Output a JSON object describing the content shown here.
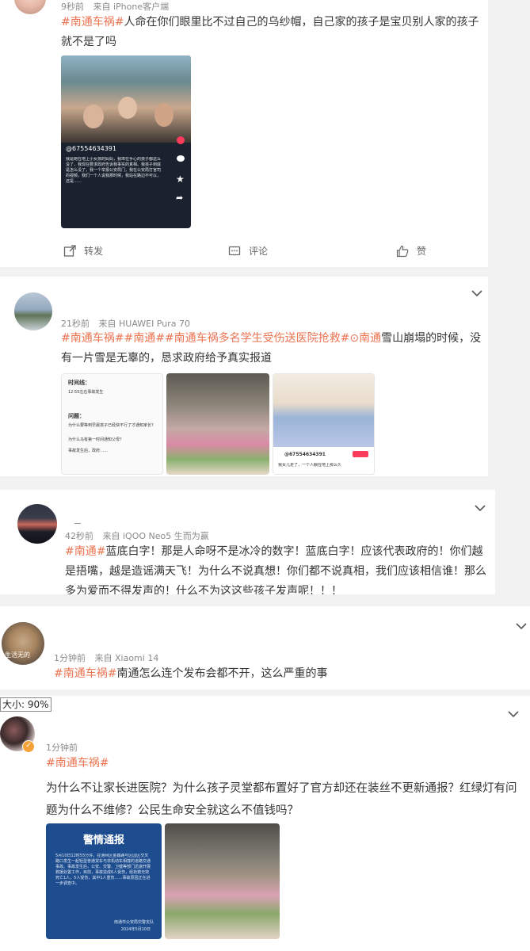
{
  "posts": [
    {
      "meta": "9秒前",
      "source": "来自 iPhone客户端",
      "tag": "#南通车祸#",
      "text": "人命在你们眼里比不过自己的乌纱帽，自己家的孩子是宝贝别人家的孩子就不是了吗",
      "video": {
        "handle": "@67554634391",
        "caption": "我是她在地上小女孩的妈妈，我埠在手心的孩子都这么没了，我现在要求政府告诉我事实的真相。我孩子到底是怎么没了，我一个举报公安局门，我在公安局打官司的视频，我们一个人说我那时候，我站在路边不可以，还是……"
      },
      "actions": {
        "repost": "转发",
        "comment": "评论",
        "like": "赞"
      }
    },
    {
      "meta": "21秒前",
      "source": "来自 HUAWEI Pura 70",
      "tags": [
        "#南通车祸#",
        "#南通#",
        "#南通车祸多名学生受伤送医院抢救#",
        "南通"
      ],
      "text": "雪山崩塌的时候，没有一片雪是无辜的，恳求政府给予真实报道",
      "image1": {
        "title": "时间线：",
        "line": "12:55左右事故发生",
        "sub": "问题：",
        "q1": "为什么要等到早晨孩子已经快不行了才通知家长？",
        "q2": "为什么马有第一时间通知父母？",
        "q3": "事故发生后，政府……"
      },
      "image3": {
        "handle": "@67554634391",
        "caption": "我女儿走了，一个人躺在地上那么久"
      }
    },
    {
      "meta": "42秒前",
      "source": "来自 iQOO Neo5 生而为赢",
      "tag": "#南通#",
      "text": "蓝底白字！那是人命呀不是冰冷的数字！蓝底白字！应该代表政府的！你们越是捂嘴，越是造谣满天飞！为什么不说真想！你们都不说真相，我们应该相信谁！那么多为爱而不得发声的！什么不为这这些孩子发声呢！！！"
    },
    {
      "meta": "1分钟前",
      "source": "来自 Xiaomi 14",
      "avatar_text": "生活无的",
      "tag": "#南通车祸#",
      "text": "南通怎么连个发布会都不开，这么严重的事"
    },
    {
      "zoom": "大小: 90%",
      "meta": "1分钟前",
      "tag": "#南通车祸#",
      "text": "为什么不让家长进医院？为什么孩子灵堂都布置好了官方却还在装丝不更新通报？红绿灯有问题为什么不维修？公民生命安全就这么不值钱吗？",
      "notice": {
        "title": "警情通报",
        "body": "5月10日12时55分许，在通州区金鑫路与区园区交叉路口发生一起轻型普通货车与非机动车相撞的道路交通事故。事故发生后，公安、交警、卫健等部门迅速开展救援处置工作，目前，事故造成6人受伤，经抢救无效死亡1人，5人受伤，其中1人重伤……事故原因正在进一步调查中。",
        "sign": "南通市公安局交警支队",
        "date": "2024年5月10日"
      }
    }
  ],
  "colors": {
    "accent": "#eb7350",
    "notice_blue": "#1d4d8e"
  }
}
